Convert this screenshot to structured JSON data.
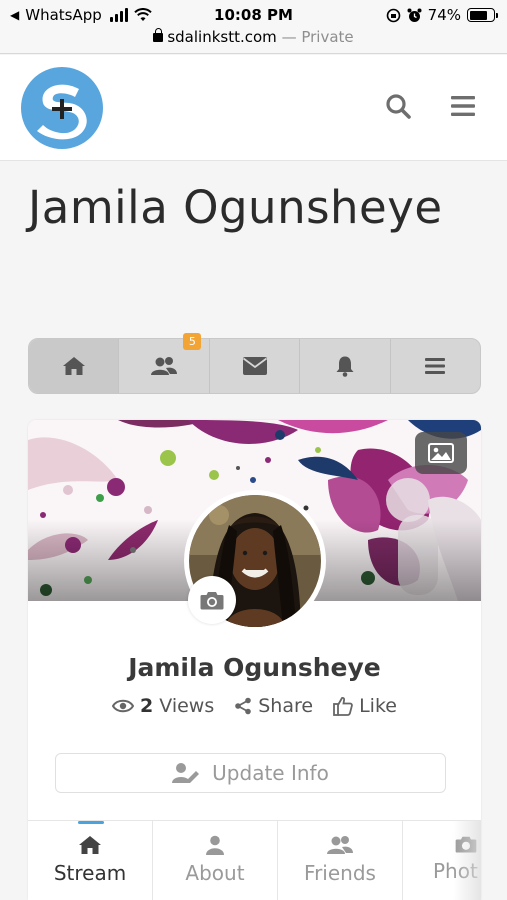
{
  "status_bar": {
    "back_app": "WhatsApp",
    "time": "10:08 PM",
    "battery": "74%",
    "battery_level": 0.74
  },
  "url_bar": {
    "domain": "sdalinkstt.com",
    "separator": "—",
    "mode": "Private"
  },
  "header": {
    "logo_icon": "sdalink-logo",
    "search_icon": "search-icon",
    "menu_icon": "hamburger-menu-icon"
  },
  "page": {
    "title": "Jamila Ogunsheye"
  },
  "nav": {
    "items": [
      {
        "icon": "home-icon"
      },
      {
        "icon": "friends-icon",
        "badge": "5"
      },
      {
        "icon": "envelope-icon"
      },
      {
        "icon": "bell-icon"
      },
      {
        "icon": "menu-icon"
      }
    ],
    "colors": {
      "badge": "#f2a535"
    }
  },
  "profile": {
    "name": "Jamila Ogunsheye",
    "views_count": "2",
    "views_label": "Views",
    "share_label": "Share",
    "like_label": "Like",
    "update_info_label": "Update Info"
  },
  "tabs": [
    {
      "label": "Stream",
      "icon": "home-icon",
      "active": true
    },
    {
      "label": "About",
      "icon": "user-icon",
      "active": false
    },
    {
      "label": "Friends",
      "icon": "friends-icon",
      "active": false
    },
    {
      "label": "Phot",
      "icon": "camera-icon",
      "active": false
    }
  ],
  "colors": {
    "accent": "#4aa3df",
    "logo_bg": "#58a6dd"
  }
}
